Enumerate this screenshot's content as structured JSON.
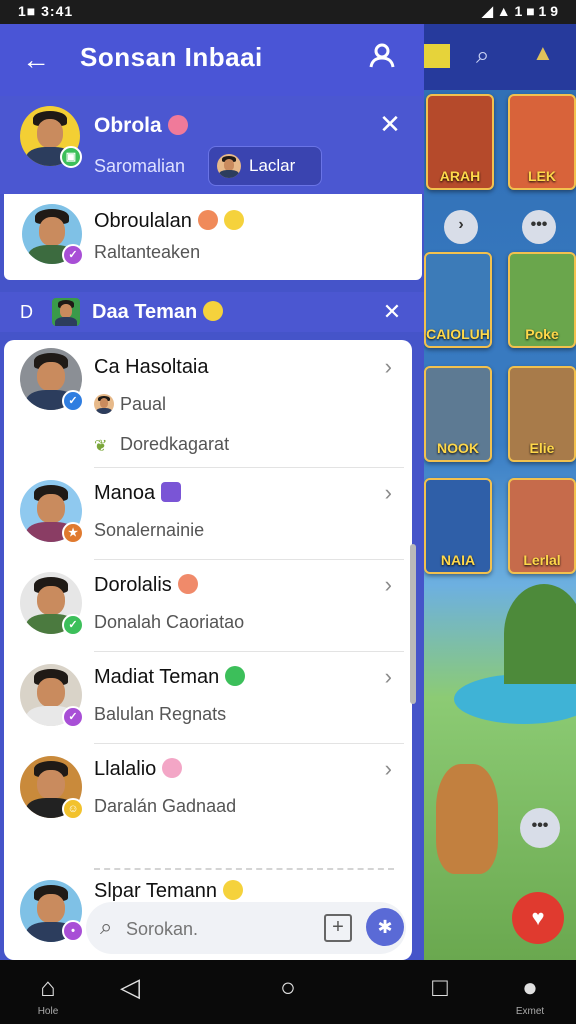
{
  "status_bar": {
    "time": "1■ 3:41",
    "right": "◢ ▲ 1 ■ 1 9"
  },
  "header": {
    "title": "Sonsan Inbaai"
  },
  "notification": {
    "name": "Obrola",
    "sub": "Saromalian",
    "chip": "Laclar"
  },
  "card1": {
    "name": "Obroulalan",
    "sub": "Raltanteaken"
  },
  "section": {
    "prefix": "D",
    "title": "Daa Teman"
  },
  "contacts": [
    {
      "name": "Ca Hasoltaia",
      "sub": "Paual",
      "sub2": "Doredkagarat",
      "badge_color": "#2f7de0"
    },
    {
      "name": "Manoa",
      "sub": "Sonalernainie",
      "badge_color": "#e07a2f"
    },
    {
      "name": "Dorolalis",
      "sub": "Donalah Caoriatao",
      "badge_color": "#3cbf5a"
    },
    {
      "name": "Madiat Teman",
      "sub": "Balulan Regnats",
      "badge_color": "#a84fd6"
    },
    {
      "name": "Llalalio",
      "sub": "Daralán Gadnaad",
      "badge_color": "#f2c22d"
    },
    {
      "name": "Slpar Temann",
      "sub": "",
      "badge_color": "#a84fd6"
    }
  ],
  "search": {
    "placeholder": "Sorokan."
  },
  "game_tiles": [
    "ARAH",
    "LEK",
    "CAIOLUH",
    "Poke",
    "NOOK",
    "Elie",
    "NAIA",
    "Lerlal"
  ],
  "nav": {
    "home_label": "Hole",
    "profile_label": "Exmet"
  },
  "colors": {
    "accent": "#4a55d6",
    "panel": "#4b57d1",
    "fab_red": "#e03a2f"
  }
}
